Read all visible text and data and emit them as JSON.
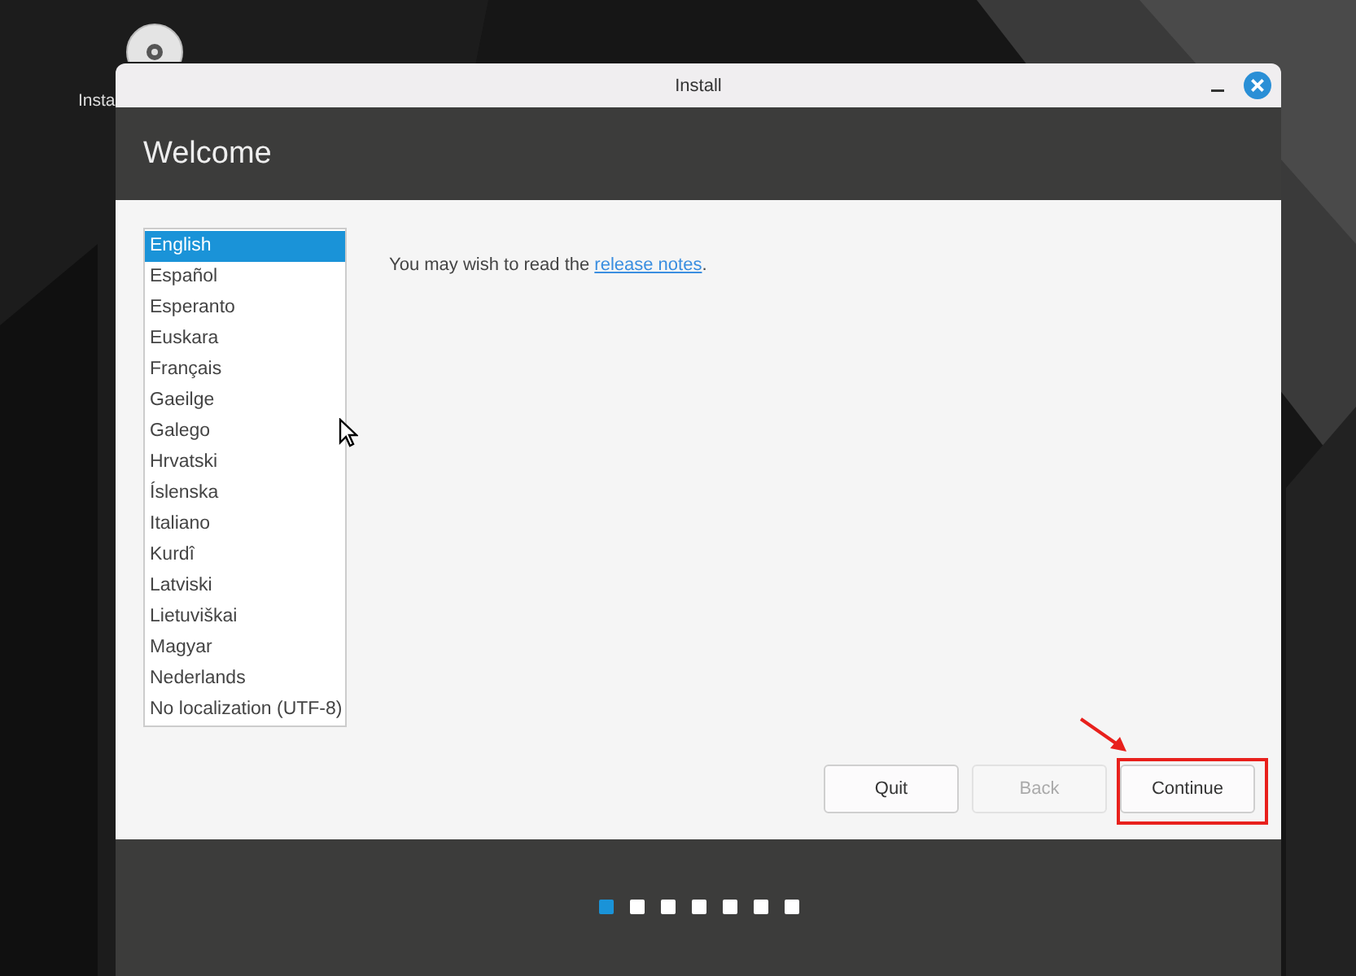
{
  "desktop": {
    "icon_label": "Insta"
  },
  "window": {
    "title": "Install"
  },
  "header": {
    "title": "Welcome"
  },
  "languages": [
    {
      "label": "English",
      "selected": true
    },
    {
      "label": "Español",
      "selected": false
    },
    {
      "label": "Esperanto",
      "selected": false
    },
    {
      "label": "Euskara",
      "selected": false
    },
    {
      "label": "Français",
      "selected": false
    },
    {
      "label": "Gaeilge",
      "selected": false
    },
    {
      "label": "Galego",
      "selected": false
    },
    {
      "label": "Hrvatski",
      "selected": false
    },
    {
      "label": "Íslenska",
      "selected": false
    },
    {
      "label": "Italiano",
      "selected": false
    },
    {
      "label": "Kurdî",
      "selected": false
    },
    {
      "label": "Latviski",
      "selected": false
    },
    {
      "label": "Lietuviškai",
      "selected": false
    },
    {
      "label": "Magyar",
      "selected": false
    },
    {
      "label": "Nederlands",
      "selected": false
    },
    {
      "label": "No localization (UTF-8)",
      "selected": false
    }
  ],
  "notes": {
    "text": "You may wish to read the",
    "link": "release notes",
    "end": "."
  },
  "buttons": [
    {
      "label": "Quit",
      "disabled": false,
      "highlighted": false
    },
    {
      "label": "Back",
      "disabled": true,
      "highlighted": false
    },
    {
      "label": "Continue",
      "disabled": false,
      "highlighted": true
    }
  ],
  "steps": [
    {
      "selected": true
    },
    {
      "selected": false
    },
    {
      "selected": false
    },
    {
      "selected": false
    },
    {
      "selected": false
    },
    {
      "selected": false
    },
    {
      "selected": false
    }
  ]
}
